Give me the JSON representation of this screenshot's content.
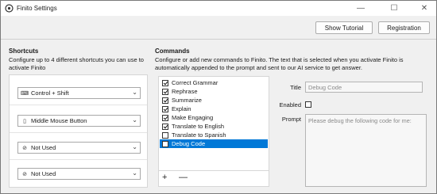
{
  "window": {
    "title": "Finito Settings",
    "min_glyph": "—",
    "max_glyph": "☐",
    "close_glyph": "✕"
  },
  "header": {
    "tutorial_label": "Show Tutorial",
    "registration_label": "Registration"
  },
  "shortcuts": {
    "title": "Shortcuts",
    "description": "Configure up to 4 different shortcuts you can use to activate Finito",
    "items": [
      {
        "icon": "keyboard-icon",
        "glyph": "⌨",
        "value": "Control + Shift"
      },
      {
        "icon": "mouse-icon",
        "glyph": "▯",
        "value": "Middle Mouse Button"
      },
      {
        "icon": "block-icon",
        "glyph": "⊘",
        "value": "Not Used"
      },
      {
        "icon": "block-icon",
        "glyph": "⊘",
        "value": "Not Used"
      }
    ]
  },
  "commands": {
    "title": "Commands",
    "description": "Configure or add new commands to Finito. The text that is selected when you activate Finito is automatically appended to the prompt and sent to our AI service to get answer.",
    "items": [
      {
        "label": "Correct Grammar",
        "checked": true
      },
      {
        "label": "Rephrase",
        "checked": true
      },
      {
        "label": "Summarize",
        "checked": true
      },
      {
        "label": "Explain",
        "checked": true
      },
      {
        "label": "Make Engaging",
        "checked": true
      },
      {
        "label": "Translate to English",
        "checked": true
      },
      {
        "label": "Translate to Spanish",
        "checked": false
      },
      {
        "label": "Debug Code",
        "checked": false,
        "selected": true
      }
    ],
    "add_label": "+",
    "remove_label": "—"
  },
  "detail": {
    "title_label": "Title",
    "title_value": "Debug Code",
    "enabled_label": "Enabled",
    "enabled": false,
    "prompt_label": "Prompt",
    "prompt_value": "Please debug the following code for me:"
  },
  "colors": {
    "selection": "#0078d7",
    "background": "#f0f0f0",
    "panel": "#ffffff"
  }
}
